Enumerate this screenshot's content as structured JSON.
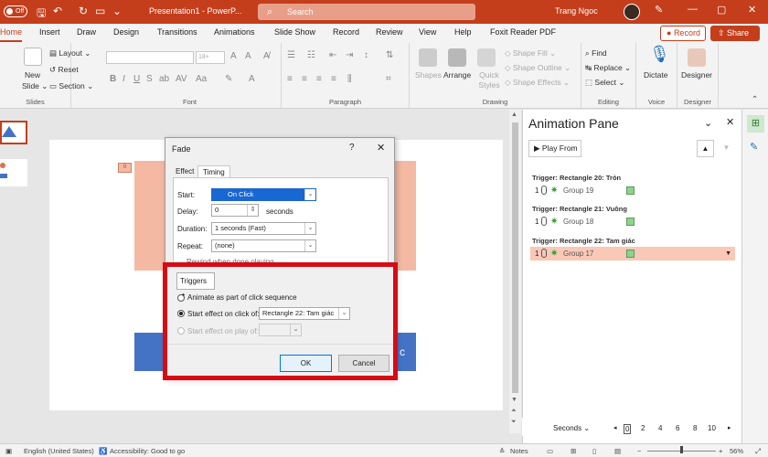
{
  "titlebar": {
    "autosave": "Off",
    "doc_title": "Presentation1 - PowerP...",
    "search_placeholder": "Search",
    "user_name": "Trang Ngoc"
  },
  "tabs": [
    "Home",
    "Insert",
    "Draw",
    "Design",
    "Transitions",
    "Animations",
    "Slide Show",
    "Record",
    "Review",
    "View",
    "Help",
    "Foxit Reader PDF"
  ],
  "record_label": "Record",
  "share_label": "Share",
  "ribbon": {
    "slides": {
      "new_slide": "New\nSlide",
      "layout": "Layout",
      "reset": "Reset",
      "section": "Section",
      "label": "Slides"
    },
    "font": {
      "size": "18+",
      "label": "Font"
    },
    "paragraph": {
      "label": "Paragraph"
    },
    "drawing": {
      "shapes": "Shapes",
      "arrange": "Arrange",
      "quick_styles": "Quick Styles",
      "shape_fill": "Shape Fill",
      "shape_outline": "Shape Outline",
      "shape_effects": "Shape Effects",
      "label": "Drawing"
    },
    "editing": {
      "find": "Find",
      "replace": "Replace",
      "select": "Select",
      "label": "Editing"
    },
    "voice": {
      "dictate": "Dictate",
      "label": "Voice"
    },
    "designer": {
      "designer": "Designer",
      "label": "Designer"
    }
  },
  "slide": {
    "trigger_marker": "0",
    "blue_text": "c"
  },
  "dialog": {
    "title": "Fade",
    "help": "?",
    "tabs": [
      "Effect",
      "Timing"
    ],
    "start_label": "Start:",
    "start_value": "On Click",
    "delay_label": "Delay:",
    "delay_value": "0",
    "delay_unit": "seconds",
    "duration_label": "Duration:",
    "duration_value": "1 seconds (Fast)",
    "repeat_label": "Repeat:",
    "repeat_value": "(none)",
    "rewind_label": "Rewind when done playing",
    "triggers_label": "Triggers",
    "opt_animate": "Animate as part of click sequence",
    "opt_click": "Start effect on click of:",
    "opt_click_value": "Rectangle 22: Tam giác",
    "opt_play": "Start effect on play of:",
    "ok": "OK",
    "cancel": "Cancel"
  },
  "pane": {
    "title": "Animation Pane",
    "play_from": "Play From",
    "triggers": [
      {
        "head": "Trigger: Rectangle 20: Tròn",
        "num": "1",
        "name": "Group 19",
        "selected": false
      },
      {
        "head": "Trigger: Rectangle 21: Vuông",
        "num": "1",
        "name": "Group 18",
        "selected": false
      },
      {
        "head": "Trigger: Rectangle 22: Tam giác",
        "num": "1",
        "name": "Group 17",
        "selected": true
      }
    ],
    "timeline_label": "Seconds",
    "timeline_ticks": [
      "0",
      "2",
      "4",
      "6",
      "8",
      "10"
    ]
  },
  "status": {
    "language": "English (United States)",
    "accessibility": "Accessibility: Good to go",
    "notes": "Notes",
    "zoom": "56%"
  },
  "colors": {
    "accent": "#c43e1c",
    "dialog_highlight": "#d80a14"
  }
}
